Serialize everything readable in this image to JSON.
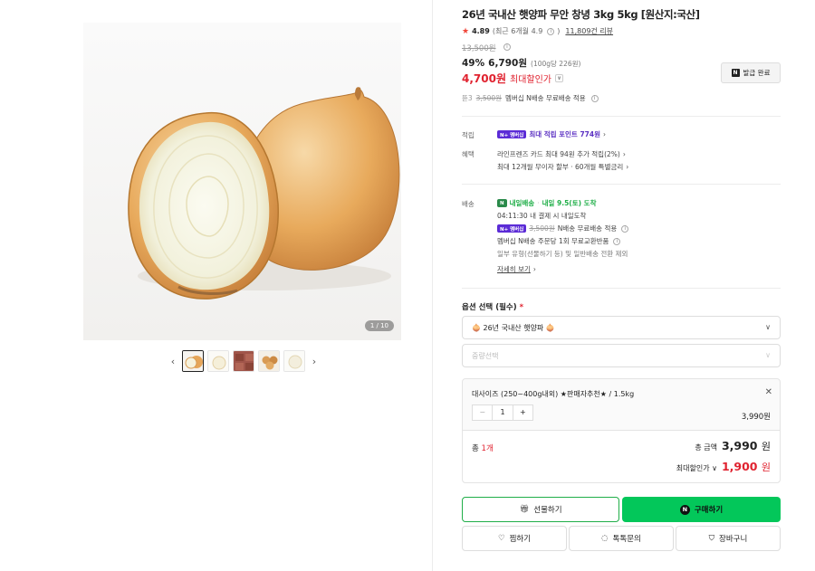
{
  "product": {
    "title": "26년 국내산 햇양파 무안 창녕 3kg 5kg [원산지:국산]",
    "rating": "4.89",
    "rating_recent": "(최근 6개월 4.9",
    "review_count": "11,809건 리뷰",
    "original_price": "13,500원",
    "discount_rate": "49%",
    "sale_price": "6,790원",
    "unit_price": "(100g당 226원)",
    "max_discount_value": "4,700원",
    "max_discount_label": "최대할인가",
    "coupon_button": "발급 완료",
    "shipping_note_prefix": "뜯3",
    "shipping_note_strike": "3,500원",
    "shipping_note": "멤버십 N배송 무료배송 적용"
  },
  "image": {
    "counter": "1 / 10",
    "prev_icon": "chevron-left-icon",
    "next_icon": "chevron-right-icon"
  },
  "benefits": {
    "points_label": "적립",
    "points_badge": "N+ 멤버십",
    "points_text": "최대 적립 포인트 774원",
    "perks_label": "혜택",
    "perk1": "라인프렌즈 카드 최대 94원 추가 적립(2%)",
    "perk2": "최대 12개월 무이자 할부 · 60개월 특별금리"
  },
  "delivery": {
    "label": "배송",
    "fast_badge": "N",
    "fast_text": "내일배송",
    "arrival": "내일 9.5(토) 도착",
    "cutoff": "04:11:30  내 결제 시 내일도착",
    "member_badge": "N+ 멤버십",
    "member_strike": "3,500원",
    "member_text": "N배송 무료배송 적용",
    "exchange": "멤버십 N배송 주문당 1회 무료교환반품",
    "exclude": "일부 유형(선물하기 등) 및 일반배송 전환 제외",
    "more": "자세히 보기"
  },
  "options": {
    "label": "옵션 선택 (필수)",
    "required_mark": "*",
    "select1_value": "🧅 26년 국내산 햇양파 🧅",
    "select2_placeholder": "중량선택"
  },
  "selected": {
    "name": "대사이즈 (250~400g내외) ★판매자추천★ / 1.5kg",
    "qty": "1",
    "minus": "−",
    "plus": "+",
    "price": "3,990원",
    "total_prefix": "총",
    "total_count": "1개",
    "total_label": "총 금액",
    "total_value": "3,990",
    "total_unit": "원",
    "max_label": "최대할인가 ∨",
    "max_value": "1,900",
    "max_unit": "원"
  },
  "buttons": {
    "gift": "선물하기",
    "buy": "구매하기",
    "wish": "찜하기",
    "talk": "톡톡문의",
    "cart": "장바구니"
  },
  "colors": {
    "accent_red": "#e0222f",
    "naver_green": "#03c75a",
    "membership_purple": "#5b2bd6"
  }
}
